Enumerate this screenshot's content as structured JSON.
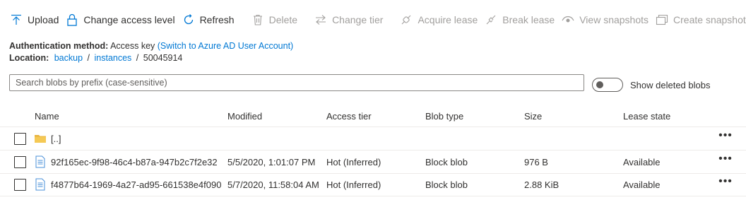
{
  "toolbar": {
    "upload": "Upload",
    "change_access_level": "Change access level",
    "refresh": "Refresh",
    "delete": "Delete",
    "change_tier": "Change tier",
    "acquire_lease": "Acquire lease",
    "break_lease": "Break lease",
    "view_snapshots": "View snapshots",
    "create_snapshot": "Create snapshot"
  },
  "auth": {
    "label": "Authentication method:",
    "value": "Access key",
    "switch_link": "(Switch to Azure AD User Account)"
  },
  "location": {
    "label": "Location:",
    "crumbs": [
      "backup",
      "instances"
    ],
    "sep": "/",
    "current": "50045914"
  },
  "search": {
    "placeholder": "Search blobs by prefix (case-sensitive)"
  },
  "toggle": {
    "label": "Show deleted blobs",
    "on": false
  },
  "table": {
    "headers": {
      "name": "Name",
      "modified": "Modified",
      "access_tier": "Access tier",
      "blob_type": "Blob type",
      "size": "Size",
      "lease_state": "Lease state"
    },
    "parent": {
      "name": "[..]"
    },
    "rows": [
      {
        "name": "92f165ec-9f98-46c4-b87a-947b2c7f2e32",
        "modified": "5/5/2020, 1:01:07 PM",
        "access_tier": "Hot (Inferred)",
        "blob_type": "Block blob",
        "size": "976 B",
        "lease_state": "Available"
      },
      {
        "name": "f4877b64-1969-4a27-ad95-661538e4f090",
        "modified": "5/7/2020, 11:58:04 AM",
        "access_tier": "Hot (Inferred)",
        "blob_type": "Block blob",
        "size": "2.88 KiB",
        "lease_state": "Available"
      }
    ],
    "more": "•••"
  },
  "colors": {
    "accent": "#0078d4",
    "disabled_text": "#a19f9d",
    "folder": "#e8b440",
    "file": "#4a90d9"
  }
}
